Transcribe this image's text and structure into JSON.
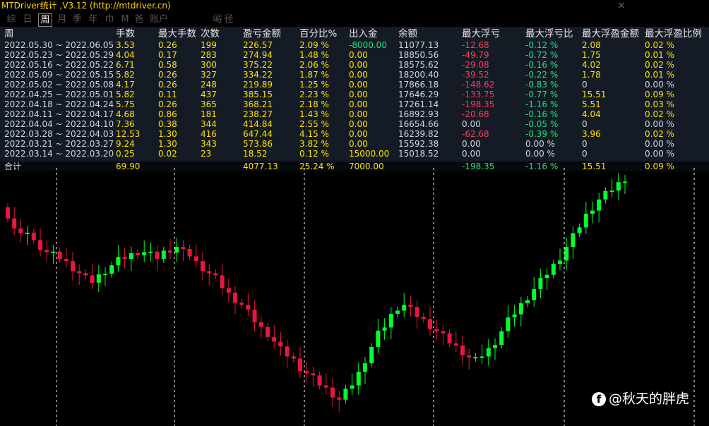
{
  "app": {
    "title": "MTDriver统计 ,V3.12 (http://mtdriver.cn)",
    "close_icon": "×"
  },
  "tabs": [
    "综",
    "日",
    "周",
    "月",
    "季",
    "年",
    "巾",
    "M",
    "爸",
    "账户",
    "",
    "峪",
    "径"
  ],
  "active_tab": 2,
  "table": {
    "columns": [
      "周",
      "手数",
      "最大手数",
      "次数",
      "盈亏金额",
      "百分比%",
      "出入金",
      "余额",
      "最大浮亏",
      "最大浮亏比",
      "最大浮盈金额",
      "最大浮盈比例"
    ],
    "rows": [
      [
        "2022.05.30 ~ 2022.06.05",
        "3.53",
        "0.26",
        "199",
        "226.57",
        "2.09 %",
        "-8000.00",
        "11077.13",
        "-12.68",
        "-0.12 %",
        "2.08",
        "0.02 %"
      ],
      [
        "2022.05.23 ~ 2022.05.29",
        "4.04",
        "0.17",
        "283",
        "274.94",
        "1.48 %",
        "0.00",
        "18850.56",
        "-49.79",
        "-0.72 %",
        "1.75",
        "0.01 %"
      ],
      [
        "2022.05.16 ~ 2022.05.22",
        "6.71",
        "0.58",
        "300",
        "375.22",
        "2.06 %",
        "0.00",
        "18575.62",
        "-29.08",
        "-0.16 %",
        "4.02",
        "0.02 %"
      ],
      [
        "2022.05.09 ~ 2022.05.15",
        "5.82",
        "0.26",
        "327",
        "334.22",
        "1.87 %",
        "0.00",
        "18200.40",
        "-39.52",
        "-0.22 %",
        "1.78",
        "0.01 %"
      ],
      [
        "2022.05.02 ~ 2022.05.08",
        "4.17",
        "0.26",
        "248",
        "219.89",
        "1.25 %",
        "0.00",
        "17866.18",
        "-148.62",
        "-0.83 %",
        "0",
        "0.00 %"
      ],
      [
        "2022.04.25 ~ 2022.05.01",
        "5.82",
        "0.11",
        "437",
        "385.15",
        "2.23 %",
        "0.00",
        "17646.29",
        "-133.75",
        "-0.77 %",
        "15.51",
        "0.09 %"
      ],
      [
        "2022.04.18 ~ 2022.04.24",
        "5.75",
        "0.26",
        "365",
        "368.21",
        "2.18 %",
        "0.00",
        "17261.14",
        "-198.35",
        "-1.16 %",
        "5.51",
        "0.03 %"
      ],
      [
        "2022.04.11 ~ 2022.04.17",
        "4.68",
        "0.86",
        "181",
        "238.27",
        "1.43 %",
        "0.00",
        "16892.93",
        "-20.68",
        "-0.16 %",
        "4.04",
        "0.02 %"
      ],
      [
        "2022.04.04 ~ 2022.04.10",
        "7.36",
        "0.38",
        "344",
        "414.84",
        "2.55 %",
        "0.00",
        "16654.66",
        "0.00",
        "-0.05 %",
        "0",
        "0.00 %"
      ],
      [
        "2022.03.28 ~ 2022.04.03",
        "12.53",
        "1.30",
        "416",
        "647.44",
        "4.15 %",
        "0.00",
        "16239.82",
        "-62.68",
        "-0.39 %",
        "3.96",
        "0.02 %"
      ],
      [
        "2022.03.21 ~ 2022.03.27",
        "9.24",
        "1.30",
        "343",
        "573.86",
        "3.82 %",
        "0.00",
        "15592.38",
        "0.00",
        "0.00 %",
        "0",
        "0.00 %"
      ],
      [
        "2022.03.14 ~ 2022.03.20",
        "0.25",
        "0.02",
        "23",
        "18.52",
        "0.12 %",
        "15000.00",
        "15018.52",
        "0.00",
        "0.00 %",
        "0",
        "0.00 %"
      ]
    ],
    "total": [
      "合计",
      "69.90",
      "",
      "",
      "4077.13",
      "25.24 %",
      "7000.00",
      "",
      "-198.35",
      "-1.16 %",
      "15.51",
      "0.09 %"
    ]
  },
  "colors": {
    "up": "#00ff2f",
    "down": "#e8173f",
    "panel_bg": "#141b25",
    "text_yellow": "#ffe200",
    "text_red": "#ff3b5c",
    "text_green": "#21e07a",
    "grid": "#ffffff"
  },
  "watermark": {
    "icon": "f",
    "text": "@秋天的胖虎"
  }
}
